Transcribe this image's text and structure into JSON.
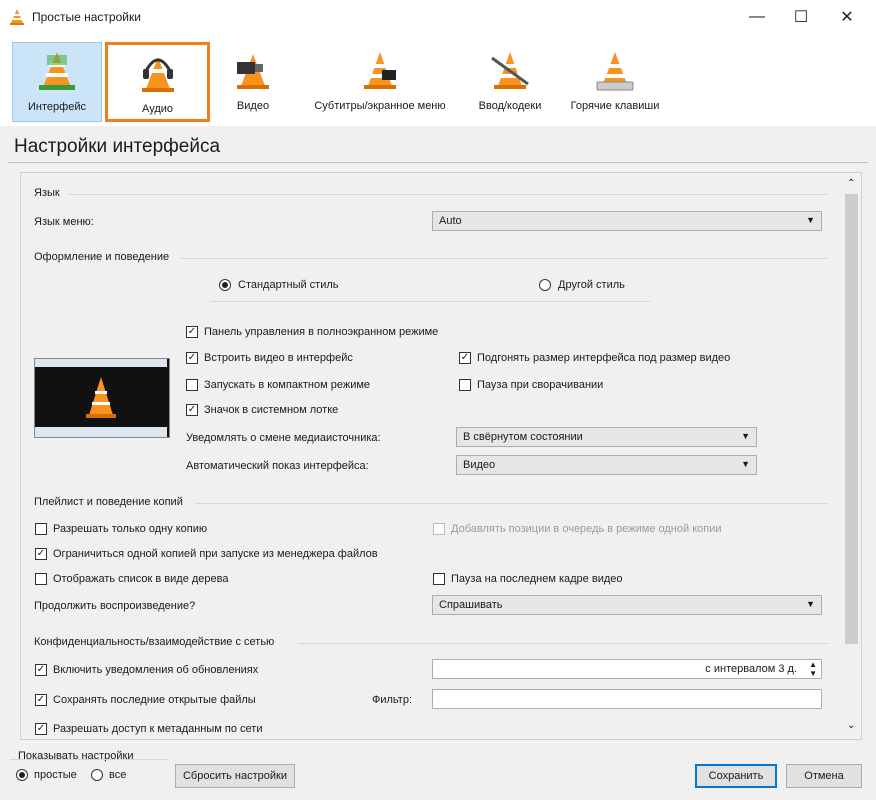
{
  "window": {
    "title": "Простые настройки",
    "minimize_icon": "minimize-icon",
    "maximize_icon": "maximize-icon",
    "close_icon": "close-icon"
  },
  "toolbar": {
    "items": [
      {
        "label": "Интерфейс",
        "icon": "vlc-cone-interface-icon",
        "selected": true
      },
      {
        "label": "Аудио",
        "icon": "vlc-cone-headphones-icon",
        "highlighted": true
      },
      {
        "label": "Видео",
        "icon": "vlc-cone-video-icon"
      },
      {
        "label": "Субтитры/экранное меню",
        "icon": "vlc-cone-subtitles-icon"
      },
      {
        "label": "Ввод/кодеки",
        "icon": "vlc-cone-codecs-icon"
      },
      {
        "label": "Горячие клавиши",
        "icon": "vlc-cone-hotkeys-icon"
      }
    ]
  },
  "heading": "Настройки интерфейса",
  "language": {
    "group": "Язык",
    "menu_language_label": "Язык меню:",
    "menu_language_value": "Auto"
  },
  "appearance": {
    "group": "Оформление и поведение",
    "style_standard": "Стандартный стиль",
    "style_other": "Другой стиль",
    "fullscreen_controls": "Панель управления в полноэкранном режиме",
    "embed_video": "Встроить видео в интерфейс",
    "resize_interface": "Подгонять размер интерфейса под размер видео",
    "compact_mode": "Запускать в компактном режиме",
    "pause_minimized": "Пауза при сворачивании",
    "systray_icon": "Значок в системном лотке",
    "notify_label": "Уведомлять о смене медиаисточника:",
    "notify_value": "В свёрнутом состоянии",
    "autoshow_label": "Автоматический показ интерфейса:",
    "autoshow_value": "Видео"
  },
  "playlist": {
    "group": "Плейлист и поведение копий",
    "one_instance": "Разрешать только одну копию",
    "enqueue_one_instance": "Добавлять позиции в очередь в режиме одной копии",
    "file_manager_one_instance": "Ограничиться одной копией при запуске из менеджера файлов",
    "tree_view": "Отображать список в виде дерева",
    "pause_last_frame": "Пауза на последнем кадре видео",
    "continue_label": "Продолжить воспроизведение?",
    "continue_value": "Спрашивать"
  },
  "privacy": {
    "group": "Конфиденциальность/взаимодействие с сетью",
    "updates": "Включить уведомления об обновлениях",
    "updates_interval": "с интервалом 3 д.",
    "recent_files": "Сохранять последние открытые файлы",
    "filter_label": "Фильтр:",
    "filter_value": "",
    "metadata_access": "Разрешать доступ к метаданным по сети"
  },
  "footer": {
    "show_settings_label": "Показывать настройки",
    "simple": "простые",
    "all": "все",
    "reset": "Сбросить настройки",
    "save": "Сохранить",
    "cancel": "Отмена"
  },
  "colors": {
    "selected_bg": "#cce4f7",
    "highlight_border": "#f07e1a",
    "accent": "#0078d7"
  }
}
